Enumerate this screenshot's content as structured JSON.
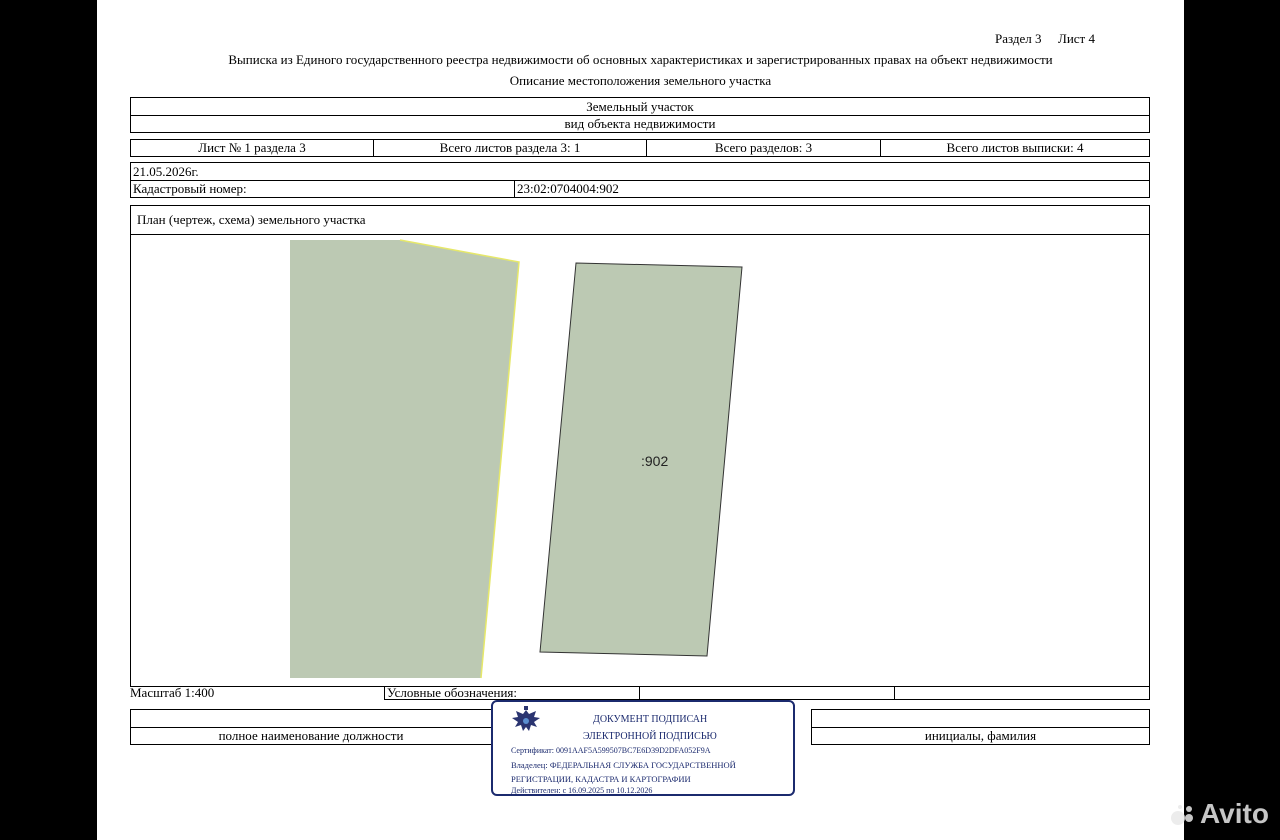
{
  "header": {
    "section": "Раздел 3",
    "sheet": "Лист 4",
    "title": "Выписка из Единого государственного реестра недвижимости об основных характеристиках и зарегистрированных правах на объект недвижимости",
    "subtitle": "Описание местоположения земельного участка"
  },
  "object": {
    "type": "Земельный участок",
    "type_caption": "вид объекта недвижимости"
  },
  "sheet_info": {
    "sheet_no": "Лист № 1 раздела 3",
    "sheets_in_section": "Всего листов раздела 3: 1",
    "sections_total": "Всего разделов: 3",
    "sheets_total": "Всего листов выписки: 4"
  },
  "date": "21.05.2026г.",
  "cadastral": {
    "label": "Кадастровый номер:",
    "value": "23:02:0704004:902"
  },
  "plan": {
    "heading": "План (чертеж, схема) земельного участка",
    "parcel_label": ":902",
    "fill_color": "#bcc9b3",
    "edge_highlight": "#e6e86a"
  },
  "footer": {
    "scale": "Масштаб 1:400",
    "legend": "Условные обозначения:",
    "position_caption": "полное наименование должности",
    "initials_caption": "инициалы, фамилия"
  },
  "stamp": {
    "line1": "ДОКУМЕНТ ПОДПИСАН",
    "line2": "ЭЛЕКТРОННОЙ ПОДПИСЬЮ",
    "certificate": "Сертификат: 0091AAF5A599507BC7E6D39D2DFA052F9A",
    "owner1": "Владелец: ФЕДЕРАЛЬНАЯ СЛУЖБА ГОСУДАРСТВЕННОЙ",
    "owner2": "РЕГИСТРАЦИИ, КАДАСТРА И КАРТОГРАФИИ",
    "valid": "Действителен: с 16.09.2025 по 10.12.2026",
    "color": "#1b2a6e",
    "emblem_icon": "double-headed-eagle-icon"
  },
  "watermark": {
    "text": "Avito",
    "icon": "avito-dots-icon"
  }
}
